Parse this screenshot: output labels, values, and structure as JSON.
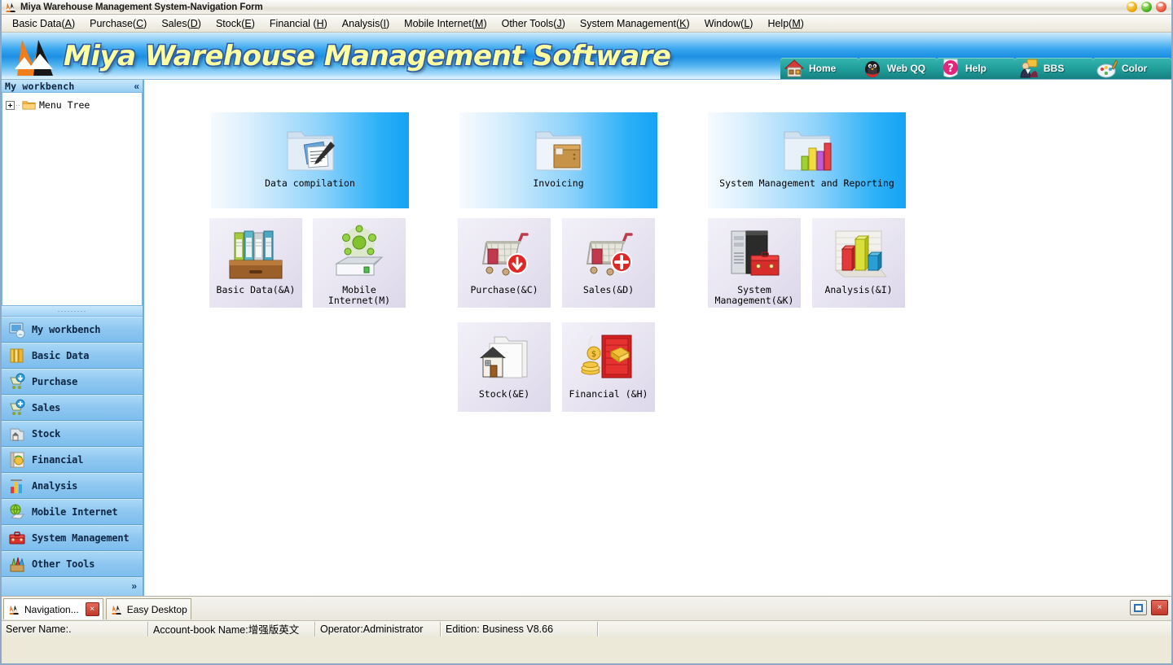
{
  "window": {
    "title": "Miya Warehouse Management System-Navigation Form",
    "minimize_label": "",
    "maximize_label": "",
    "close_label": ""
  },
  "menubar": {
    "items": [
      {
        "label": "Basic Data(A)",
        "text": "Basic Data(",
        "key": "A",
        "tail": ")"
      },
      {
        "label": "Purchase(C)",
        "text": "Purchase(",
        "key": "C",
        "tail": ")"
      },
      {
        "label": "Sales(D)",
        "text": "Sales(",
        "key": "D",
        "tail": ")"
      },
      {
        "label": "Stock(E)",
        "text": "Stock(",
        "key": "E",
        "tail": ")"
      },
      {
        "label": "Financial (H)",
        "text": "Financial (",
        "key": "H",
        "tail": ")"
      },
      {
        "label": "Analysis(I)",
        "text": "Analysis(",
        "key": "I",
        "tail": ")"
      },
      {
        "label": "Mobile Internet(M)",
        "text": "Mobile Internet(",
        "key": "M",
        "tail": ")"
      },
      {
        "label": "Other Tools(J)",
        "text": "Other Tools(",
        "key": "J",
        "tail": ")"
      },
      {
        "label": "System Management(K)",
        "text": "System Management(",
        "key": "K",
        "tail": ")"
      },
      {
        "label": "Window(L)",
        "text": "Window(",
        "key": "L",
        "tail": ")"
      },
      {
        "label": "Help(M)",
        "text": "Help(",
        "key": "M",
        "tail": ")"
      }
    ]
  },
  "banner": {
    "title": "Miya Warehouse Management Software",
    "tools": [
      {
        "label": "Home",
        "icon": "house-icon"
      },
      {
        "label": "Web QQ",
        "icon": "penguin-icon"
      },
      {
        "label": "Help",
        "icon": "question-mark-icon"
      },
      {
        "label": "BBS",
        "icon": "person-icon"
      },
      {
        "label": "Color",
        "icon": "palette-icon"
      }
    ]
  },
  "sidebar": {
    "header_title": "My workbench",
    "collapse_glyph": "«",
    "expand_glyph": "»",
    "tree": [
      {
        "label": "Menu Tree",
        "icon": "folder-icon",
        "expanded": false
      }
    ],
    "items": [
      {
        "label": "My workbench",
        "icon": "workbench-icon"
      },
      {
        "label": "Basic Data",
        "icon": "books-icon"
      },
      {
        "label": "Purchase",
        "icon": "cart-down-icon"
      },
      {
        "label": "Sales",
        "icon": "cart-plus-icon"
      },
      {
        "label": "Stock",
        "icon": "warehouse-icon"
      },
      {
        "label": "Financial",
        "icon": "money-book-icon"
      },
      {
        "label": "Analysis",
        "icon": "bar-chart-icon"
      },
      {
        "label": "Mobile Internet",
        "icon": "globe-disk-icon"
      },
      {
        "label": "System Management",
        "icon": "toolbox-icon"
      },
      {
        "label": "Other Tools",
        "icon": "tools-icon"
      }
    ]
  },
  "main": {
    "groups": [
      {
        "label": "Data compilation",
        "icon": "folder-documents-icon"
      },
      {
        "label": "Invoicing",
        "icon": "folder-box-icon"
      },
      {
        "label": "System Management and Reporting",
        "icon": "folder-chart-icon"
      }
    ],
    "tiles": [
      {
        "label": "Basic Data(&A)",
        "icon": "binders-icon"
      },
      {
        "label": "Mobile Internet(M)",
        "icon": "network-disk-icon"
      },
      {
        "label": "Purchase(&C)",
        "icon": "cart-download-icon"
      },
      {
        "label": "Sales(&D)",
        "icon": "cart-add-icon"
      },
      {
        "label": "System Management(&K)",
        "icon": "server-toolbox-icon"
      },
      {
        "label": "Analysis(&I)",
        "icon": "chart-3d-icon"
      },
      {
        "label": "Stock(&E)",
        "icon": "house-folder-icon"
      },
      {
        "label": "Financial (&H)",
        "icon": "safe-money-icon"
      }
    ]
  },
  "taskbar": {
    "tasks": [
      {
        "label": "Navigation...",
        "active": true,
        "has_close": true,
        "close_label": "×"
      },
      {
        "label": "Easy Desktop",
        "active": false,
        "has_close": false,
        "close_label": ""
      }
    ],
    "window_controls": [
      {
        "name": "restore",
        "label": ""
      },
      {
        "name": "close",
        "label": "×"
      }
    ]
  },
  "statusbar": {
    "cells": [
      "Server Name:.",
      "Account-book Name:增强版英文",
      "Operator:Administrator",
      "Edition:  Business V8.66",
      ""
    ]
  },
  "colors": {
    "banner_blue": "#1d8fe3",
    "banner_title_yellow": "#ffffa0",
    "sidebar_blue": "#8ec6f0",
    "tool_teal": "#1f9d9a",
    "close_red": "#c0392b"
  }
}
